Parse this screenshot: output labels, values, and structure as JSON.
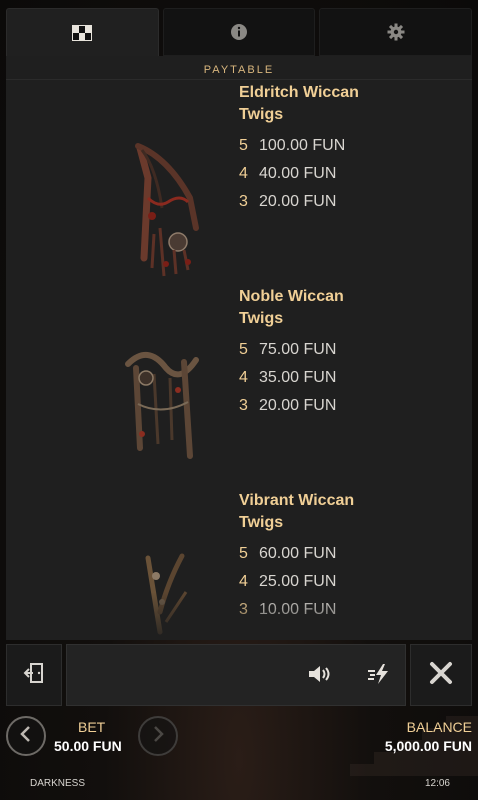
{
  "tabs": [
    {
      "name": "paytable",
      "icon": "checkered-grid-icon",
      "active": true
    },
    {
      "name": "info",
      "icon": "info-icon",
      "active": false
    },
    {
      "name": "settings",
      "icon": "gear-icon",
      "active": false
    }
  ],
  "section_title": "PAYTABLE",
  "symbols": [
    {
      "name_line1": "Eldritch Wiccan",
      "name_line2": "Twigs",
      "pays": [
        {
          "count": "5",
          "amount": "100.00 FUN"
        },
        {
          "count": "4",
          "amount": "40.00 FUN"
        },
        {
          "count": "3",
          "amount": "20.00 FUN"
        }
      ]
    },
    {
      "name_line1": "Noble Wiccan",
      "name_line2": "Twigs",
      "pays": [
        {
          "count": "5",
          "amount": "75.00 FUN"
        },
        {
          "count": "4",
          "amount": "35.00 FUN"
        },
        {
          "count": "3",
          "amount": "20.00 FUN"
        }
      ]
    },
    {
      "name_line1": "Vibrant Wiccan",
      "name_line2": "Twigs",
      "pays": [
        {
          "count": "5",
          "amount": "60.00 FUN"
        },
        {
          "count": "4",
          "amount": "25.00 FUN"
        },
        {
          "count": "3",
          "amount": "10.00 FUN"
        }
      ]
    }
  ],
  "controls": {
    "exit_icon": "exit-door-icon",
    "sound_icon": "speaker-icon",
    "turbo_icon": "lightning-speed-icon",
    "close_icon": "close-icon"
  },
  "status": {
    "bet_label": "BET",
    "bet_value": "50.00 FUN",
    "balance_label": "BALANCE",
    "balance_value": "5,000.00 FUN",
    "game_name": "DARKNESS",
    "clock": "12:06"
  },
  "colors": {
    "accent_gold": "#f0cf96",
    "panel_bg": "#1f1f1f",
    "background": "#0d0c0b"
  }
}
